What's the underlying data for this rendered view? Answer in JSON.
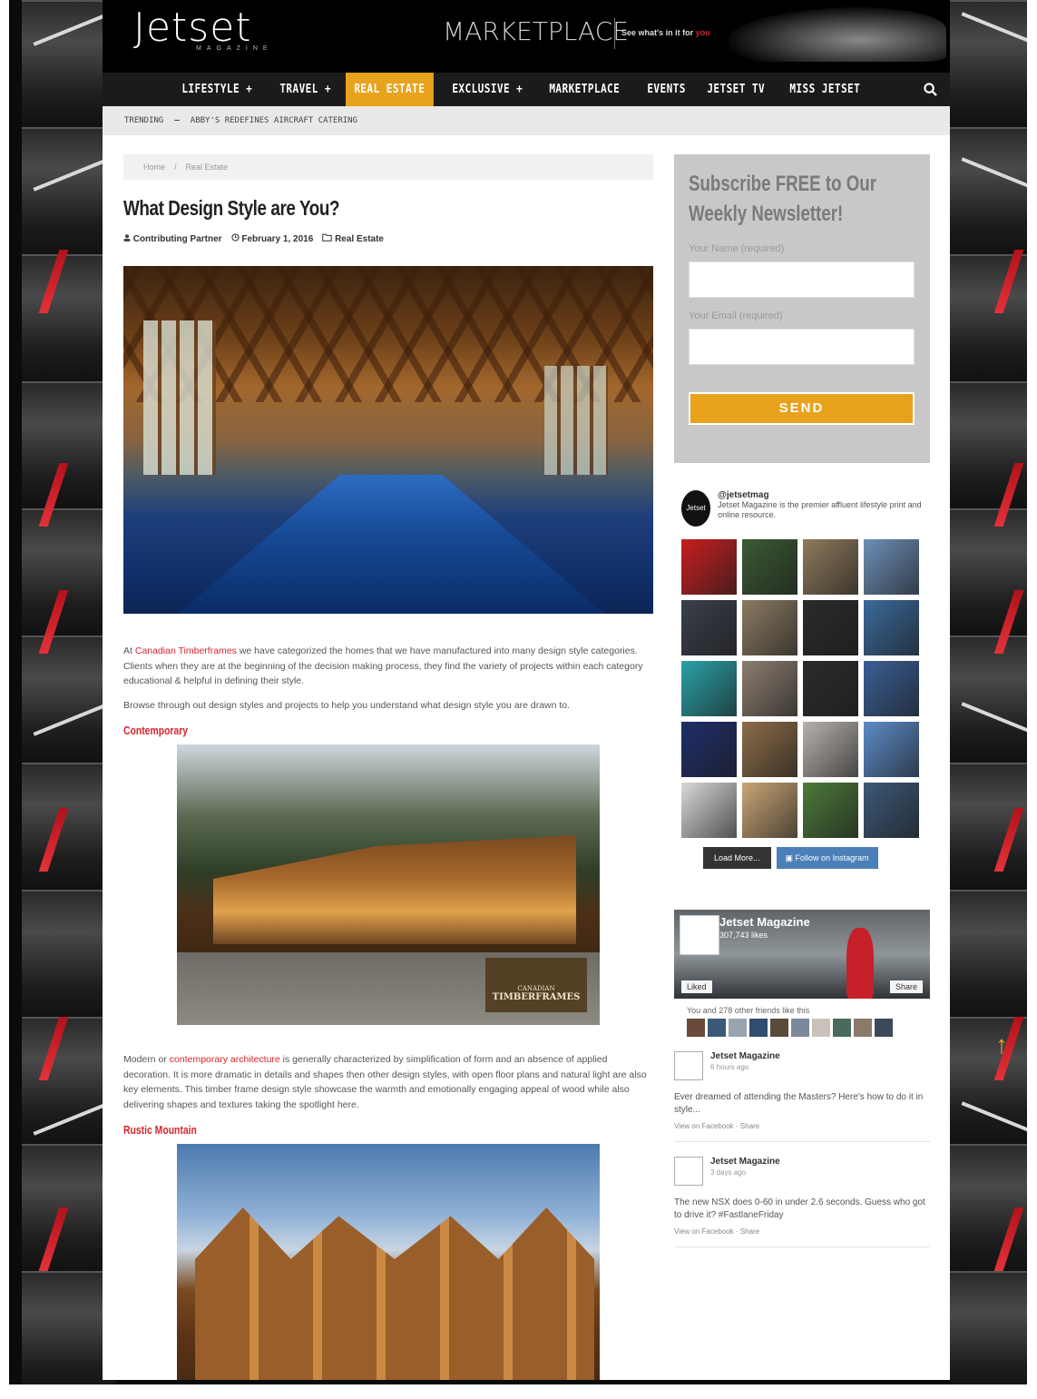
{
  "header": {
    "logo": "Jetset",
    "logo_sub": "MAGAZINE",
    "marketplace": "MARKETPLACE",
    "marketplace_tag_prefix": "See what's in it for",
    "marketplace_tag_highlight": "you"
  },
  "nav": {
    "items": [
      {
        "label": "LIFESTYLE +"
      },
      {
        "label": "TRAVEL +"
      },
      {
        "label": "REAL ESTATE",
        "active": true
      },
      {
        "label": "EXCLUSIVE +"
      },
      {
        "label": "MARKETPLACE"
      },
      {
        "label": "EVENTS"
      },
      {
        "label": "JETSET TV"
      },
      {
        "label": "MISS JETSET"
      }
    ]
  },
  "trending": {
    "label": "TRENDING",
    "dash": "—",
    "text": "ABBY'S REDEFINES AIRCRAFT CATERING"
  },
  "breadcrumb": {
    "home": "Home",
    "sep": "/",
    "current": "Real Estate"
  },
  "article": {
    "title": "What Design Style are You?",
    "author": "Contributing Partner",
    "date": "February 1, 2016",
    "category": "Real Estate",
    "p1_link": "Canadian Timberframes",
    "p1_rest": " we have categorized the homes that we have manufactured into many design style categories. Clients when they are at the beginning of the decision making process, they find the variety of projects within each category educational & helpful in defining their style.",
    "p1_prefix": "At ",
    "p2": "Browse through out design styles and projects to help you understand what design style you are drawn to.",
    "section1": "Contemporary",
    "timber_logo_line1": "CANADIAN",
    "timber_logo_line2": "TIMBERFRAMES",
    "p3_prefix": "Modern or ",
    "p3_link": "contemporary architecture",
    "p3_rest": " is generally characterized by simplification of form and an absence of applied decoration. It is more dramatic in details and shapes then other design styles, with open floor plans and natural light are also key elements. This timber frame design style showcase the warmth and emotionally engaging appeal of wood while also delivering shapes and textures taking the spotlight here.",
    "section2": "Rustic Mountain"
  },
  "subscribe": {
    "title_line1": "Subscribe FREE to Our",
    "title_line2": "Weekly Newsletter!",
    "name_label": "Your Name (required)",
    "email_label": "Your Email (required)",
    "send_label": "SEND"
  },
  "instagram": {
    "handle": "@jetsetmag",
    "avatar_text": "Jetset",
    "bio": "Jetset Magazine is the premier affluent lifestyle print and online resource.",
    "tiles": [
      "#c61f1f",
      "#3b5a33",
      "#8f7a5c",
      "#6c8fb7",
      "#3a3f4a",
      "#8b7b62",
      "#2a2a2a",
      "#3a6a9a",
      "#2aa2a8",
      "#8d7e70",
      "#2b2b2b",
      "#3a5f95",
      "#1f2e6b",
      "#8c6d48",
      "#b7b2ad",
      "#5c8cc8",
      "#d9d9d9",
      "#c9a575",
      "#4c7a3a",
      "#3c5877"
    ],
    "load_more": "Load More...",
    "follow": "Follow on Instagram"
  },
  "facebook": {
    "page_name": "Jetset Magazine",
    "likes": "307,743 likes",
    "liked": "Liked",
    "share": "Share",
    "friends_text": "You and 278 other friends like this",
    "friend_colors": [
      "#6a4a3a",
      "#3b5a7a",
      "#9aa3b0",
      "#2f4d6f",
      "#5a4a3a",
      "#7a8a9a",
      "#c9c2b9",
      "#4a6a5a",
      "#8a7a6a",
      "#3a4a5a"
    ]
  },
  "posts": [
    {
      "name": "Jetset Magazine",
      "time": "6 hours ago",
      "text": "Ever dreamed of attending the Masters? Here's how to do it in style...",
      "links": "View on Facebook · Share"
    },
    {
      "name": "Jetset Magazine",
      "time": "3 days ago",
      "text": "The new NSX does 0-60 in under 2.6 seconds. Guess who got to drive it? #FastlaneFriday",
      "links": "View on Facebook · Share"
    }
  ],
  "scroll_top": "↑"
}
